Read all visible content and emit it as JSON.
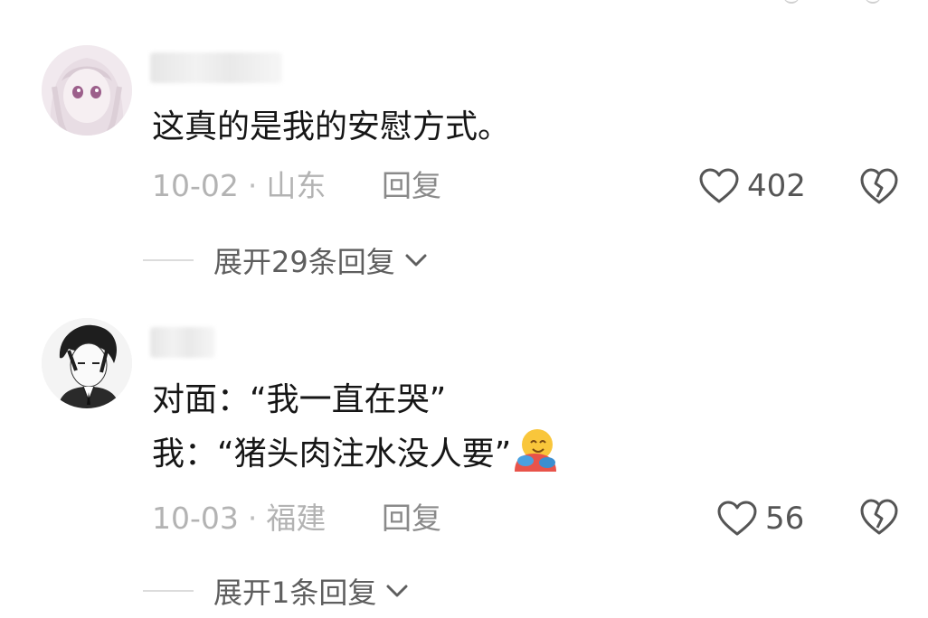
{
  "comments": [
    {
      "text_lines": [
        "这真的是我的安慰方式。"
      ],
      "date": "10-02",
      "location": "山东",
      "reply_label": "回复",
      "like_count": "402",
      "expand_label": "展开29条回复"
    },
    {
      "text_lines": [
        "对面：“我一直在哭”",
        "我：“猪头肉注水没人要”"
      ],
      "date": "10-03",
      "location": "福建",
      "reply_label": "回复",
      "like_count": "56",
      "expand_label": "展开1条回复"
    }
  ],
  "icons": {
    "like": "heart-outline-icon",
    "dislike": "broken-heart-icon",
    "expand": "chevron-down-icon",
    "emoji": "hugging-face-emoji"
  },
  "colors": {
    "text": "#161616",
    "meta": "#b3b3b3",
    "reply": "#8a8a8a",
    "icon": "#555555"
  }
}
